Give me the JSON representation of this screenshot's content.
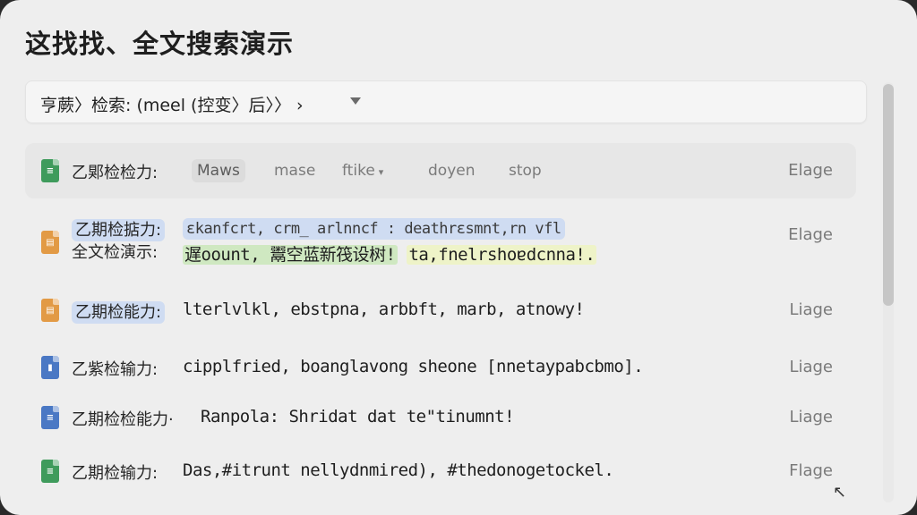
{
  "page_title": "这找找、全文搜索演示",
  "search": {
    "query": "亨蕨〉检索: (meel (控变〉后〉〉 ›"
  },
  "filters": [
    "Maws",
    "mase",
    "ftike",
    "doyen",
    "stop"
  ],
  "results": [
    {
      "icon": "spreadsheet-icon",
      "icon_color": "#3f9b5c",
      "label": "乙郹检检力:",
      "tag": "Elage"
    },
    {
      "icon": "slides-icon",
      "icon_color": "#e29a45",
      "label": "乙期检掂力:",
      "label2": "全文检演示:",
      "content_a": "ɛkanfcrt, crm_ arlnncf : deathrɛsmnt,rn vfl",
      "content_b1": "遅oount, 鬻空蓝新筏设树!",
      "content_b2": "ta,fnelrshoɐdcnna!.",
      "tag": "Elage"
    },
    {
      "icon": "slides-icon",
      "icon_color": "#e29a45",
      "label": "乙期检能力:",
      "content": "lterlvlkl, ebstpna, arbbft, marb, atnowy!",
      "tag": "Liage"
    },
    {
      "icon": "chart-doc-icon",
      "icon_color": "#4a78c4",
      "label": "乙紫检输力:",
      "content": "cipplfried, boanglavong sheone [nnetaypabcbmo].",
      "tag": "Liage"
    },
    {
      "icon": "doc-icon",
      "icon_color": "#4a78c4",
      "label": "乙期检检能力·",
      "content": "Ranpola: Shridat  dat te\"tinumnt!",
      "tag": "Liage"
    },
    {
      "icon": "spreadsheet-icon",
      "icon_color": "#3f9b5c",
      "label": "乙期检输力:",
      "content": "Das,#itrunt nellydnmired), #thedonogetockel.",
      "tag": "Flage"
    }
  ]
}
